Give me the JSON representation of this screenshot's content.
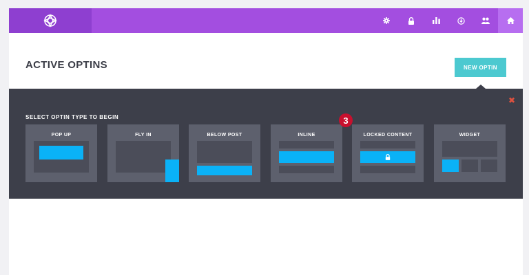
{
  "header": {
    "logo_icon": "bloom-logo-icon",
    "nav": [
      {
        "icon": "gear-icon",
        "active": false
      },
      {
        "icon": "lock-icon",
        "active": false
      },
      {
        "icon": "bar-chart-icon",
        "active": false
      },
      {
        "icon": "import-export-icon",
        "active": false
      },
      {
        "icon": "accounts-icon",
        "active": false
      },
      {
        "icon": "home-icon",
        "active": true
      }
    ],
    "colors": {
      "bar": "#a34ee0",
      "logo_bg": "#8e3fd0",
      "active": "#b76ef0"
    }
  },
  "page": {
    "title": "ACTIVE OPTINS",
    "new_optin_label": "NEW OPTIN"
  },
  "optin_panel": {
    "heading": "SELECT OPTIN TYPE TO BEGIN",
    "close_icon": "close-icon",
    "types": [
      {
        "label": "POP UP"
      },
      {
        "label": "FLY IN"
      },
      {
        "label": "BELOW POST"
      },
      {
        "label": "INLINE"
      },
      {
        "label": "LOCKED CONTENT"
      },
      {
        "label": "WIDGET"
      }
    ],
    "step_badge": "3",
    "colors": {
      "panel": "#3d3f4a",
      "card": "#5d606d",
      "accent": "#0ab2f7",
      "close": "#e0513f"
    }
  }
}
